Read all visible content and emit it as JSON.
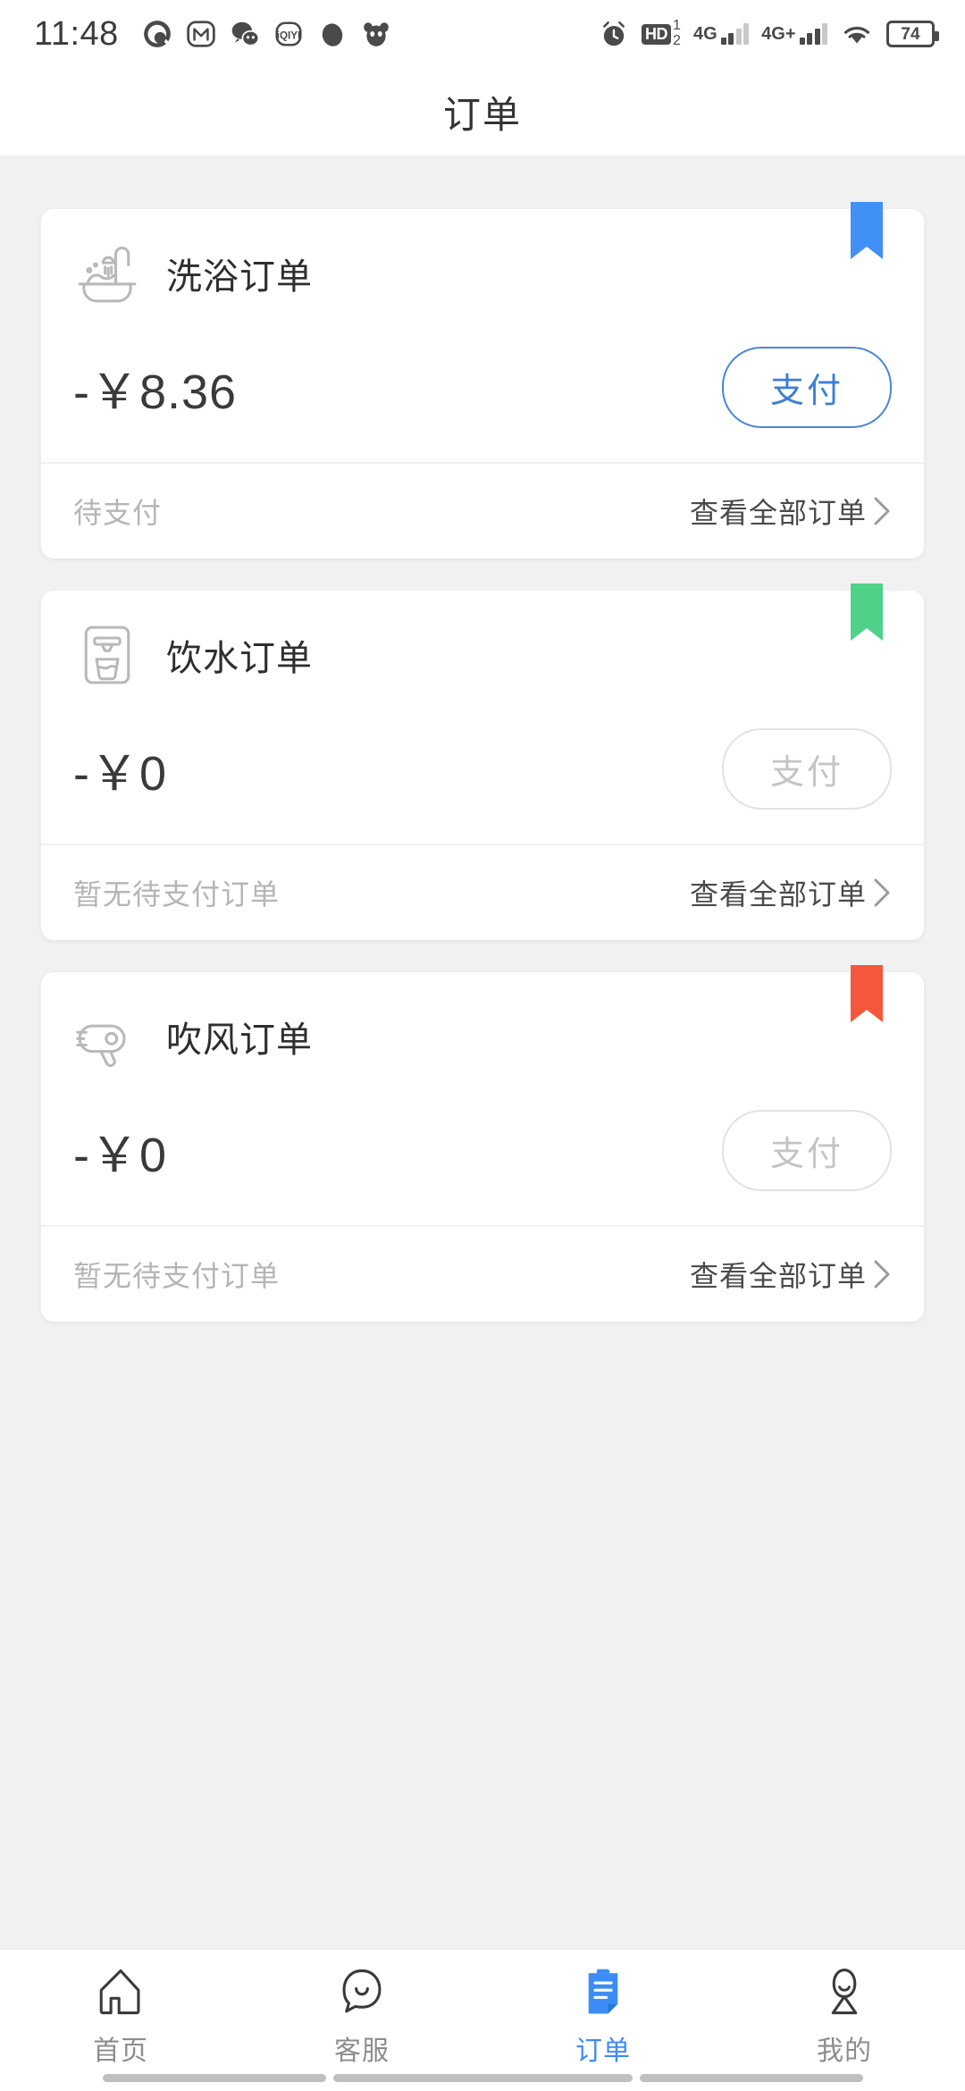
{
  "status_bar": {
    "time": "11:48",
    "app_icons": [
      "quark-icon",
      "meituan-icon",
      "wechat-icon",
      "iqiyi-icon",
      "lemon-icon",
      "panda-icon"
    ],
    "alarm_icon": "alarm-clock-icon",
    "hd_label": "HD",
    "hd_sim_top": "1",
    "hd_sim_bottom": "2",
    "network_1": "4G",
    "network_2": "4G+",
    "wifi_icon": "wifi-icon",
    "battery_level": "74"
  },
  "header": {
    "title": "订单"
  },
  "cards": [
    {
      "icon": "bathtub-shower-icon",
      "title": "洗浴订单",
      "amount": "-￥8.36",
      "pay_label": "支付",
      "pay_enabled": true,
      "status": "待支付",
      "link_label": "查看全部订单",
      "ribbon_color": "#4090f5"
    },
    {
      "icon": "water-dispenser-icon",
      "title": "饮水订单",
      "amount": "-￥0",
      "pay_label": "支付",
      "pay_enabled": false,
      "status": "暂无待支付订单",
      "link_label": "查看全部订单",
      "ribbon_color": "#4fd18a"
    },
    {
      "icon": "hair-dryer-icon",
      "title": "吹风订单",
      "amount": "-￥0",
      "pay_label": "支付",
      "pay_enabled": false,
      "status": "暂无待支付订单",
      "link_label": "查看全部订单",
      "ribbon_color": "#f4573c"
    }
  ],
  "tabbar": {
    "items": [
      {
        "icon": "home-icon",
        "label": "首页",
        "active": false
      },
      {
        "icon": "customer-service-icon",
        "label": "客服",
        "active": false
      },
      {
        "icon": "order-clipboard-icon",
        "label": "订单",
        "active": true
      },
      {
        "icon": "person-icon",
        "label": "我的",
        "active": false
      }
    ],
    "active_color": "#3d8cf5",
    "inactive_color": "#8d8d8d"
  }
}
